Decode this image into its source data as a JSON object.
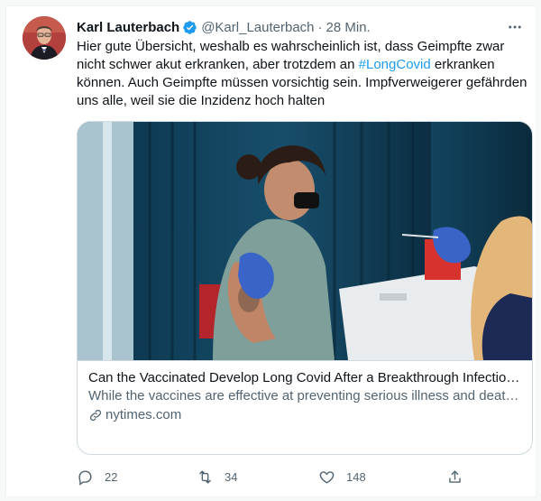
{
  "tweet": {
    "author_name": "Karl Lauterbach",
    "handle": "@Karl_Lauterbach",
    "separator": "·",
    "time": "28 Min.",
    "more_icon": "more-dots-icon",
    "text_part1": "Hier gute Übersicht, weshalb es wahrscheinlich ist, dass Geimpfte zwar nicht schwer akut erkranken, aber trotzdem an ",
    "hashtag": "#LongCovid",
    "text_part2": " erkranken können. Auch Geimpfte müssen vorsichtig sein. Impfverweigerer gefährden uns alle, weil sie die Inzidenz hoch halten"
  },
  "card": {
    "title": "Can the Vaccinated Develop Long Covid After a Breakthrough Infection?",
    "description": "While the vaccines are effective at preventing serious illness and death, the risk of developing post-Covid health problems after a breakthrough infection remains.",
    "domain": "nytimes.com",
    "image_alt": "vaccination-photo"
  },
  "actions": {
    "reply_count": "22",
    "retweet_count": "34",
    "like_count": "148"
  },
  "colors": {
    "accent": "#1d9bf0",
    "text": "#0f1419",
    "muted": "#536471",
    "border": "#cfd9de"
  }
}
